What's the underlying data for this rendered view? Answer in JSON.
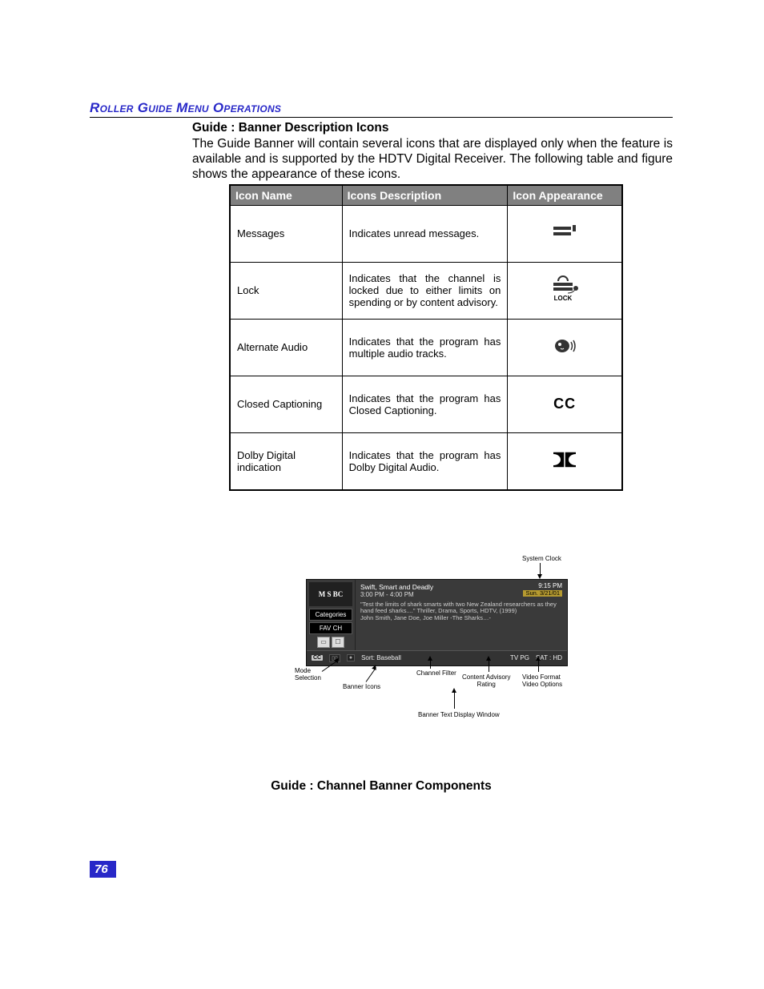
{
  "section_header": "Roller Guide Menu Operations",
  "sub_heading": "Guide : Banner Description Icons",
  "paragraph": "The Guide Banner will contain several icons that are displayed only when the feature is available and is supported by the HDTV Digital Receiver. The following table and figure shows the appearance of these icons.",
  "table": {
    "headers": {
      "c1": "Icon Name",
      "c2": "Icons Description",
      "c3": "Icon Appearance"
    },
    "rows": [
      {
        "name": "Messages",
        "desc": "Indicates unread messages.",
        "appearance": "messages-icon"
      },
      {
        "name": "Lock",
        "desc": "Indicates that the channel is locked due to either limits on spending or by content advisory.",
        "appearance": "lock-icon",
        "caption": "LOCK"
      },
      {
        "name": "Alternate Audio",
        "desc": "Indicates that the program has multiple audio tracks.",
        "appearance": "alt-audio-icon"
      },
      {
        "name": "Closed Captioning",
        "desc": "Indicates that the program has Closed Captioning.",
        "appearance": "cc-text",
        "text": "CC"
      },
      {
        "name": "Dolby Digital indication",
        "desc": "Indicates that the program has Dolby Digital Audio.",
        "appearance": "dolby-icon"
      }
    ]
  },
  "figure": {
    "labels": {
      "system_clock": "System Clock",
      "mode_selection": "Mode\nSelection",
      "banner_icons": "Banner Icons",
      "channel_filter": "Channel Filter",
      "content_advisory": "Content Advisory\nRating",
      "video_format": "Video Format\nVideo Options",
      "banner_text_window": "Banner Text Display Window"
    },
    "banner": {
      "logo": "M S BC",
      "categories": "Categories",
      "favch": "FAV CH",
      "title": "Swift, Smart and Deadly",
      "timerange": "3:00 PM - 4:00 PM",
      "clock_time": "9:15 PM",
      "clock_date": "Sun. 3/21/01",
      "description": "\"Test the limits of shark smarts with two New Zealand researchers as they hand feed sharks....\" Thriller, Drama, Sports, HDTV, (1999)\nJohn Smith, Jane Doe, Joe Miller -The Sharks…-",
      "cc": "CC",
      "dolby": "▯▯",
      "alt": "●",
      "sort": "Sort: Baseball",
      "rating": "TV PG",
      "vfmt": "SAT : HD"
    },
    "caption": "Guide : Channel Banner Components"
  },
  "page_number": "76"
}
